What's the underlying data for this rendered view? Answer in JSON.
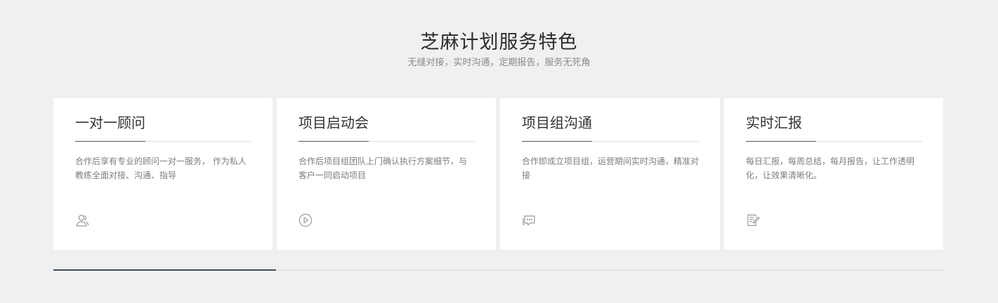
{
  "section": {
    "title": "芝麻计划服务特色",
    "subtitle": "无缝对接，实时沟通，定期报告，服务无死角"
  },
  "cards": [
    {
      "title": "一对一顾问",
      "description": "合作后享有专业的顾问一对一服务， 作为私人教练全面对接、沟通、指导",
      "icon": "users-icon"
    },
    {
      "title": "项目启动会",
      "description": "合作后项目组团队上门确认执行方案细节，与客户一同启动项目",
      "icon": "play-circle-icon"
    },
    {
      "title": "项目组沟通",
      "description": "合作即成立项目组，运营期间实时沟通，精准对接",
      "icon": "chat-icon"
    },
    {
      "title": "实时汇报",
      "description": "每日汇报，每周总结，每月报告，让工作透明化，让效果清晰化。",
      "icon": "report-edit-icon"
    }
  ],
  "carousel": {
    "progress_fraction": 0.25,
    "accent_color": "#3d4a66"
  }
}
